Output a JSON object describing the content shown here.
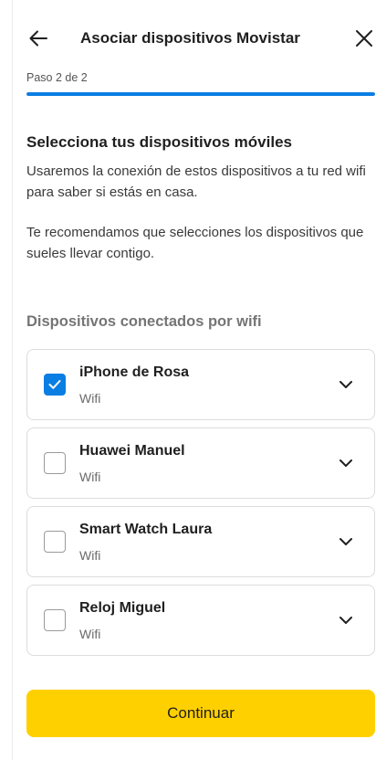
{
  "header": {
    "title": "Asociar dispositivos Movistar",
    "back_icon": "arrow-left-icon",
    "close_icon": "close-icon"
  },
  "progress": {
    "label": "Paso 2 de 2",
    "fraction": 1.0,
    "color": "#0b7ee3"
  },
  "intro": {
    "title": "Selecciona tus dispositivos móviles",
    "paragraph_1": "Usaremos la conexión de estos dispositivos a tu red wifi para saber si estás en casa.",
    "paragraph_2": "Te recomendamos que selecciones los dispositivos que sueles llevar contigo."
  },
  "wifi_devices": {
    "title": "Dispositivos conectados por wifi",
    "items": [
      {
        "name": "iPhone de Rosa",
        "connection": "Wifi",
        "checked": true
      },
      {
        "name": "Huawei Manuel",
        "connection": "Wifi",
        "checked": false
      },
      {
        "name": "Smart Watch Laura",
        "connection": "Wifi",
        "checked": false
      },
      {
        "name": "Reloj Miguel",
        "connection": "Wifi",
        "checked": false
      }
    ]
  },
  "footer": {
    "continue_label": "Continuar",
    "button_color": "#ffd000"
  }
}
